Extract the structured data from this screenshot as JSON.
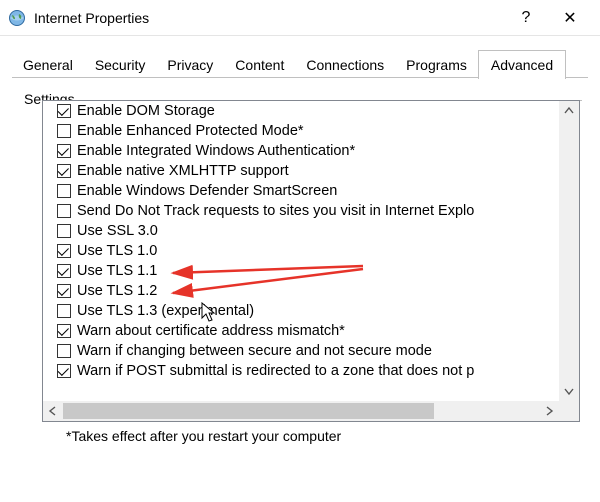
{
  "window": {
    "title": "Internet Properties"
  },
  "tabs": [
    "General",
    "Security",
    "Privacy",
    "Content",
    "Connections",
    "Programs",
    "Advanced"
  ],
  "active_tab_index": 6,
  "section_label": "Settings",
  "settings": [
    {
      "label": "Enable DOM Storage",
      "checked": true
    },
    {
      "label": "Enable Enhanced Protected Mode*",
      "checked": false
    },
    {
      "label": "Enable Integrated Windows Authentication*",
      "checked": true
    },
    {
      "label": "Enable native XMLHTTP support",
      "checked": true
    },
    {
      "label": "Enable Windows Defender SmartScreen",
      "checked": false
    },
    {
      "label": "Send Do Not Track requests to sites you visit in Internet Explo",
      "checked": false
    },
    {
      "label": "Use SSL 3.0",
      "checked": false
    },
    {
      "label": "Use TLS 1.0",
      "checked": true
    },
    {
      "label": "Use TLS 1.1",
      "checked": true
    },
    {
      "label": "Use TLS 1.2",
      "checked": true
    },
    {
      "label": "Use TLS 1.3 (experimental)",
      "checked": false
    },
    {
      "label": "Warn about certificate address mismatch*",
      "checked": true
    },
    {
      "label": "Warn if changing between secure and not secure mode",
      "checked": false
    },
    {
      "label": "Warn if POST submittal is redirected to a zone that does not p",
      "checked": true
    }
  ],
  "footnote": "*Takes effect after you restart your computer",
  "titlebar_buttons": {
    "help": "?",
    "close": "✕"
  },
  "annotation": {
    "arrows_color": "#e63329",
    "highlight_indices": [
      8,
      9
    ]
  }
}
